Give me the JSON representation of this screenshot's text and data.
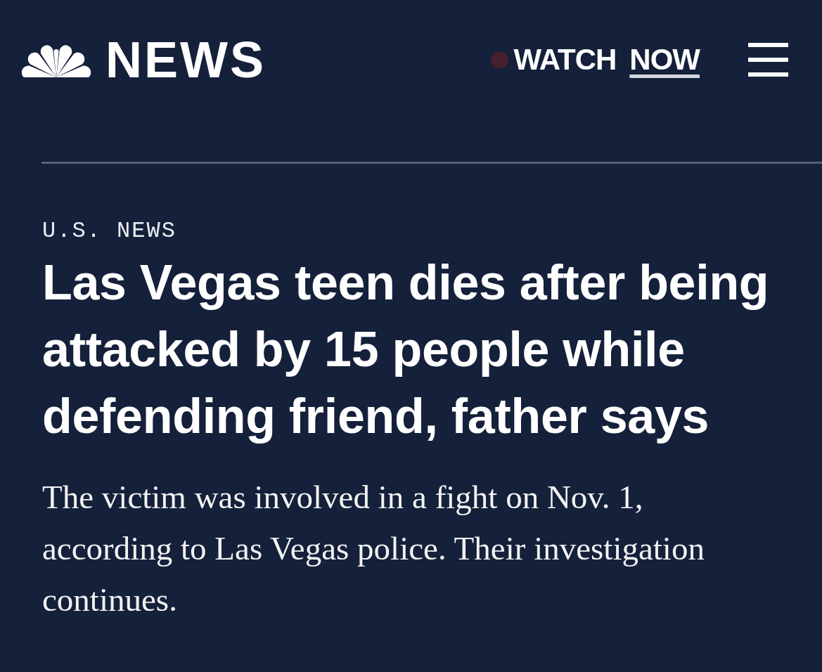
{
  "header": {
    "logo_text": "NEWS",
    "watch_link": {
      "text": "WATCH",
      "emphasis": "NOW"
    }
  },
  "article": {
    "section": "U.S. NEWS",
    "headline": "Las Vegas teen dies after being attacked by 15 people while defending friend, father says",
    "dek": "The victim was involved in a fight on Nov. 1, according to Las Vegas police. Their investigation continues."
  }
}
